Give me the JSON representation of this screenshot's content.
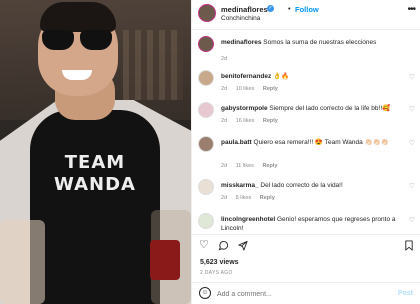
{
  "post": {
    "username": "medinaflores",
    "follow_label": "Follow",
    "location": "Conchinchina",
    "shirt_line1": "TEAM",
    "shirt_line2": "WANDA"
  },
  "caption": {
    "username": "medinaflores",
    "text": "Somos la suma de nuestras elecciones",
    "time": "2d"
  },
  "comments": [
    {
      "username": "benitofernandez",
      "text": "👌🔥",
      "time": "2d",
      "likes": "10 likes",
      "reply": "Reply"
    },
    {
      "username": "gabystormpole",
      "text": "Siempre del lado correcto de la life bb!!🥰",
      "time": "2d",
      "likes": "16 likes",
      "reply": "Reply"
    },
    {
      "username": "paula.batt",
      "text": "Quiero esa remera!!! 😍 Team Wanda 👏🏻👏🏻👏🏻",
      "time": "2d",
      "likes": "11 likes",
      "reply": "Reply"
    },
    {
      "username": "misskarma_",
      "text": "Del lado correcto de la vida!!",
      "time": "2d",
      "likes": "8 likes",
      "reply": "Reply"
    },
    {
      "username": "lincolngreenhotel",
      "text": "Genio! esperamos que regreses pronto a Lincoln!",
      "time": "",
      "likes": "",
      "reply": ""
    }
  ],
  "stats": {
    "likes": "5,623 views",
    "date": "2 DAYS AGO"
  },
  "add_comment": {
    "placeholder": "Add a comment...",
    "post_label": "Post"
  },
  "icons": {
    "heart": "heart-icon",
    "comment": "comment-icon",
    "share": "share-icon",
    "save": "bookmark-icon",
    "more": "more-icon",
    "emoji": "emoji-icon"
  },
  "colors": {
    "link": "#0095f6",
    "muted": "#8e8e8e",
    "text": "#262626"
  }
}
